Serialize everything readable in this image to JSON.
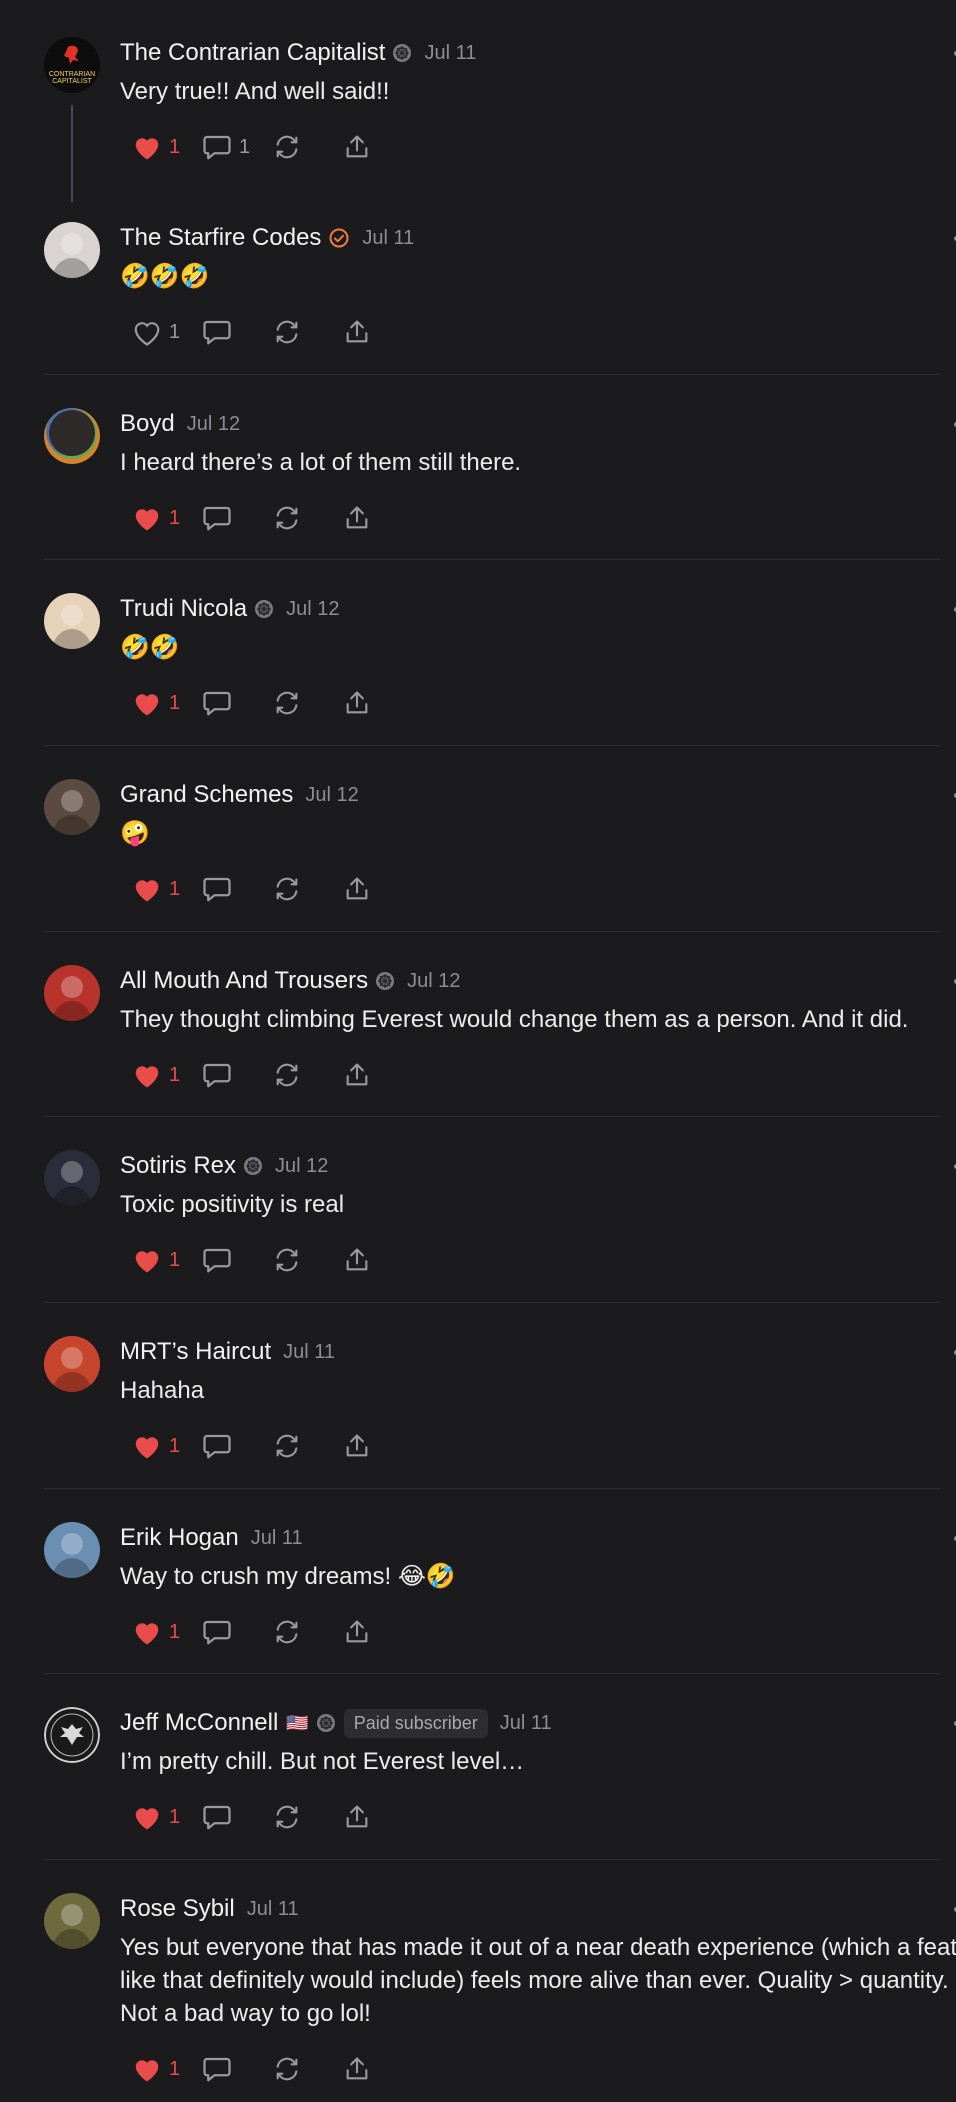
{
  "colors": {
    "background": "#1b1b1d",
    "liked_heart": "#ea4b4b",
    "muted_icon": "#8d8d92",
    "verified_orange": "#f07b3f"
  },
  "comments": [
    {
      "name": "The Contrarian Capitalist",
      "date": "Jul 11",
      "text": "Very true!! And well said!!",
      "liked": true,
      "likes": "1",
      "replies": "1",
      "badge": "founding-member-icon",
      "avatar_text": "CONTRARIAN CAPITALIST",
      "avatar_color": "#0d0d0d"
    },
    {
      "name": "The Starfire Codes",
      "date": "Jul 11",
      "text": "🤣🤣🤣",
      "liked": false,
      "likes": "1",
      "replies": "",
      "badge": "verified-check-icon",
      "avatar_color": "#d9d4d2"
    },
    {
      "name": "Boyd",
      "date": "Jul 12",
      "text": "I heard there’s a lot of them still there.",
      "liked": true,
      "likes": "1",
      "replies": "",
      "badge": "",
      "avatar_color": "#3b3534"
    },
    {
      "name": "Trudi Nicola",
      "date": "Jul 12",
      "text": "🤣🤣",
      "liked": true,
      "likes": "1",
      "replies": "",
      "badge": "founding-member-icon",
      "avatar_color": "#e6d2b8"
    },
    {
      "name": "Grand Schemes",
      "date": "Jul 12",
      "text": "🤪",
      "liked": true,
      "likes": "1",
      "replies": "",
      "badge": "",
      "avatar_color": "#5a4a40"
    },
    {
      "name": "All Mouth And Trousers",
      "date": "Jul 12",
      "text": "They thought climbing Everest would change them as a person. And it did.",
      "liked": true,
      "likes": "1",
      "replies": "",
      "badge": "founding-member-icon",
      "avatar_color": "#b8332b"
    },
    {
      "name": "Sotiris Rex",
      "date": "Jul 12",
      "text": "Toxic positivity is real",
      "liked": true,
      "likes": "1",
      "replies": "",
      "badge": "founding-member-icon",
      "avatar_color": "#2b2b3a"
    },
    {
      "name": "MRT’s Haircut",
      "date": "Jul 11",
      "text": "Hahaha",
      "liked": true,
      "likes": "1",
      "replies": "",
      "badge": "",
      "avatar_color": "#c7452c"
    },
    {
      "name": "Erik Hogan",
      "date": "Jul 11",
      "text": "Way to crush my dreams! 😂🤣",
      "liked": true,
      "likes": "1",
      "replies": "",
      "badge": "",
      "avatar_color": "#6b8fb3"
    },
    {
      "name": "Jeff McConnell",
      "date": "Jul 11",
      "text": "I’m pretty chill. But not Everest level…",
      "liked": true,
      "likes": "1",
      "replies": "",
      "badge": "founding-member-icon",
      "flag": "🇺🇸",
      "pill": "Paid subscriber",
      "avatar_color": "#1f1f1f"
    },
    {
      "name": "Rose Sybil",
      "date": "Jul 11",
      "text": "Yes but everyone that has made it out of a near death experience (which a feat like that definitely would include) feels more alive than ever. Quality > quantity. Not a bad way to go lol!",
      "liked": true,
      "likes": "1",
      "replies": "",
      "badge": "",
      "avatar_color": "#6d6a3e"
    }
  ]
}
